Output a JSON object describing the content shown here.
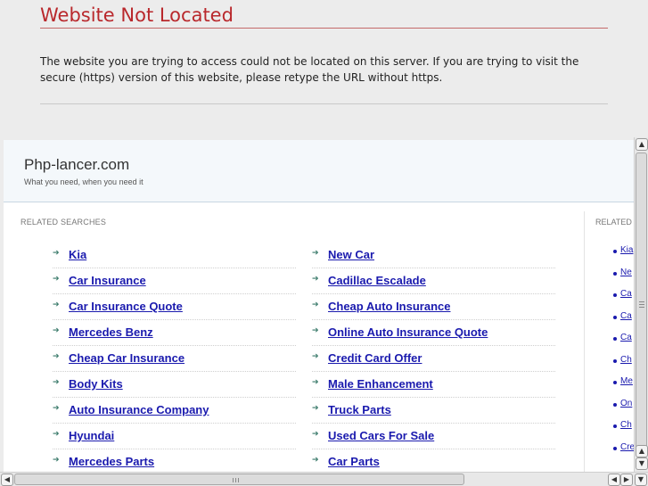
{
  "error": {
    "title": "Website Not Located",
    "message": "The website you are trying to access could not be located on this server. If you are trying to visit the secure (https) version of this website, please retype the URL without https."
  },
  "site": {
    "name": "Php-lancer.com",
    "tagline": "What you need, when you need it"
  },
  "related": {
    "label": "RELATED SEARCHES",
    "col1": [
      "Kia",
      "Car Insurance",
      "Car Insurance Quote",
      "Mercedes Benz",
      "Cheap Car Insurance",
      "Body Kits",
      "Auto Insurance Company",
      "Hyundai",
      "Mercedes Parts"
    ],
    "col2": [
      "New Car",
      "Cadillac Escalade",
      "Cheap Auto Insurance",
      "Online Auto Insurance Quote",
      "Credit Card Offer",
      "Male Enhancement",
      "Truck Parts",
      "Used Cars For Sale",
      "Car Parts"
    ]
  },
  "sidebar": {
    "label": "RELATED",
    "items": [
      "Kia",
      "Ne",
      "Ca",
      "Ca",
      "Ca",
      "Ch",
      "Me",
      "On",
      "Ch",
      "Cre"
    ]
  },
  "scrollbars": {
    "up": "▲",
    "down": "▼",
    "left": "◀",
    "right": "▶"
  }
}
